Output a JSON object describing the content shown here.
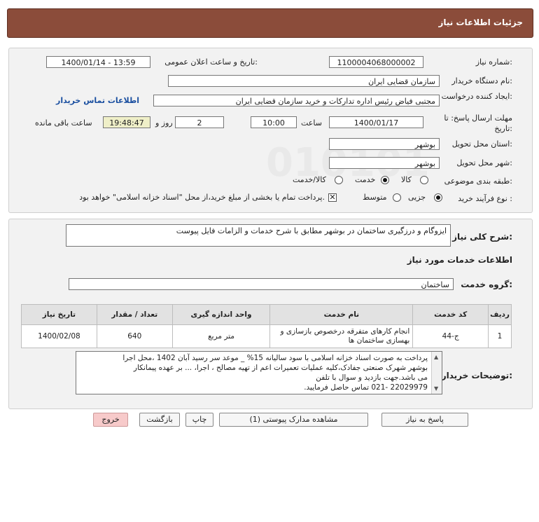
{
  "header": {
    "title": "جزئیات اطلاعات نیاز"
  },
  "form": {
    "need_number_label": "شماره نیاز:",
    "need_number": "1100004068000002",
    "announce_label": "تاریخ و ساعت اعلان عمومی:",
    "announce_value": "1400/01/14 - 13:59",
    "buyer_org_label": "نام دستگاه خریدار:",
    "buyer_org": "سازمان قضایی ایران",
    "creator_label": "ایجاد کننده درخواست:",
    "creator": "مجتبی  فیاض رئیس اداره تدارکات و خرید سازمان قضایی ایران",
    "contact_link": "اطلاعات تماس خریدار",
    "deadline_label": "مهلت ارسال پاسخ: تا تاریخ:",
    "deadline_date": "1400/01/17",
    "time_label": "ساعت",
    "deadline_time": "10:00",
    "days_value": "2",
    "days_label": "روز و",
    "remaining_time": "19:48:47",
    "remaining_label": "ساعت باقی مانده",
    "province_label": "استان محل تحویل:",
    "province": "بوشهر",
    "city_label": "شهر محل تحویل:",
    "city": "بوشهر",
    "category_label": "طبقه بندی موضوعی:",
    "category_options": [
      "کالا",
      "خدمت",
      "کالا/خدمت"
    ],
    "category_selected": "خدمت",
    "process_label": "نوع فرآیند خرید :",
    "process_options": [
      "جزیی",
      "متوسط"
    ],
    "process_selected": "جزیی",
    "payment_note": "پرداخت تمام یا بخشی از مبلغ خرید،از محل \"اسناد خزانه اسلامی\" خواهد بود."
  },
  "description": {
    "label": "شرح کلی نیاز:",
    "text": "ایزوگام و درزگیری ساختمان در بوشهر مطابق با شرح خدمات و الزامات فایل پیوست"
  },
  "services": {
    "section_title": "اطلاعات خدمات مورد نیاز",
    "group_label": "گروه خدمت:",
    "group_value": "ساختمان",
    "columns": [
      "ردیف",
      "کد خدمت",
      "نام خدمت",
      "واحد اندازه گیری",
      "تعداد / مقدار",
      "تاریخ نیاز"
    ],
    "rows": [
      [
        "1",
        "ج-44",
        "انجام کارهای متفرقه درخصوص بازسازی و بهسازی ساختمان ها",
        "متر مربع",
        "640",
        "1400/02/08"
      ]
    ]
  },
  "buyer_notes": {
    "label": "توضیحات خریدار:",
    "lines": [
      "پرداخت به صورت اسناد خزانه اسلامی با سود سالیانه 15% _ موعد سر رسید آبان 1402 ،محل اجرا",
      "بوشهر شهرک صنعتی جفادک،کلیه عملیات تعمیرات اعم از تهیه مصالح ، اجرا، ... بر عهده پیمانکار",
      "می باشد.جهت بازدید و  سوال با تلفن",
      "22029979 -021 تماس حاصل فرمایید."
    ]
  },
  "buttons": {
    "reply": "پاسخ به نیاز",
    "attachments": "مشاهده مدارک پیوستی (1)",
    "print": "چاپ",
    "back": "بازگشت",
    "exit": "خروج"
  },
  "watermark": {
    "brand": "ParsNamadData",
    "digits": "010101"
  },
  "colors": {
    "header_bg": "#8b4c3a",
    "link": "#1a4fa0",
    "exit_bg": "#f7caca"
  }
}
